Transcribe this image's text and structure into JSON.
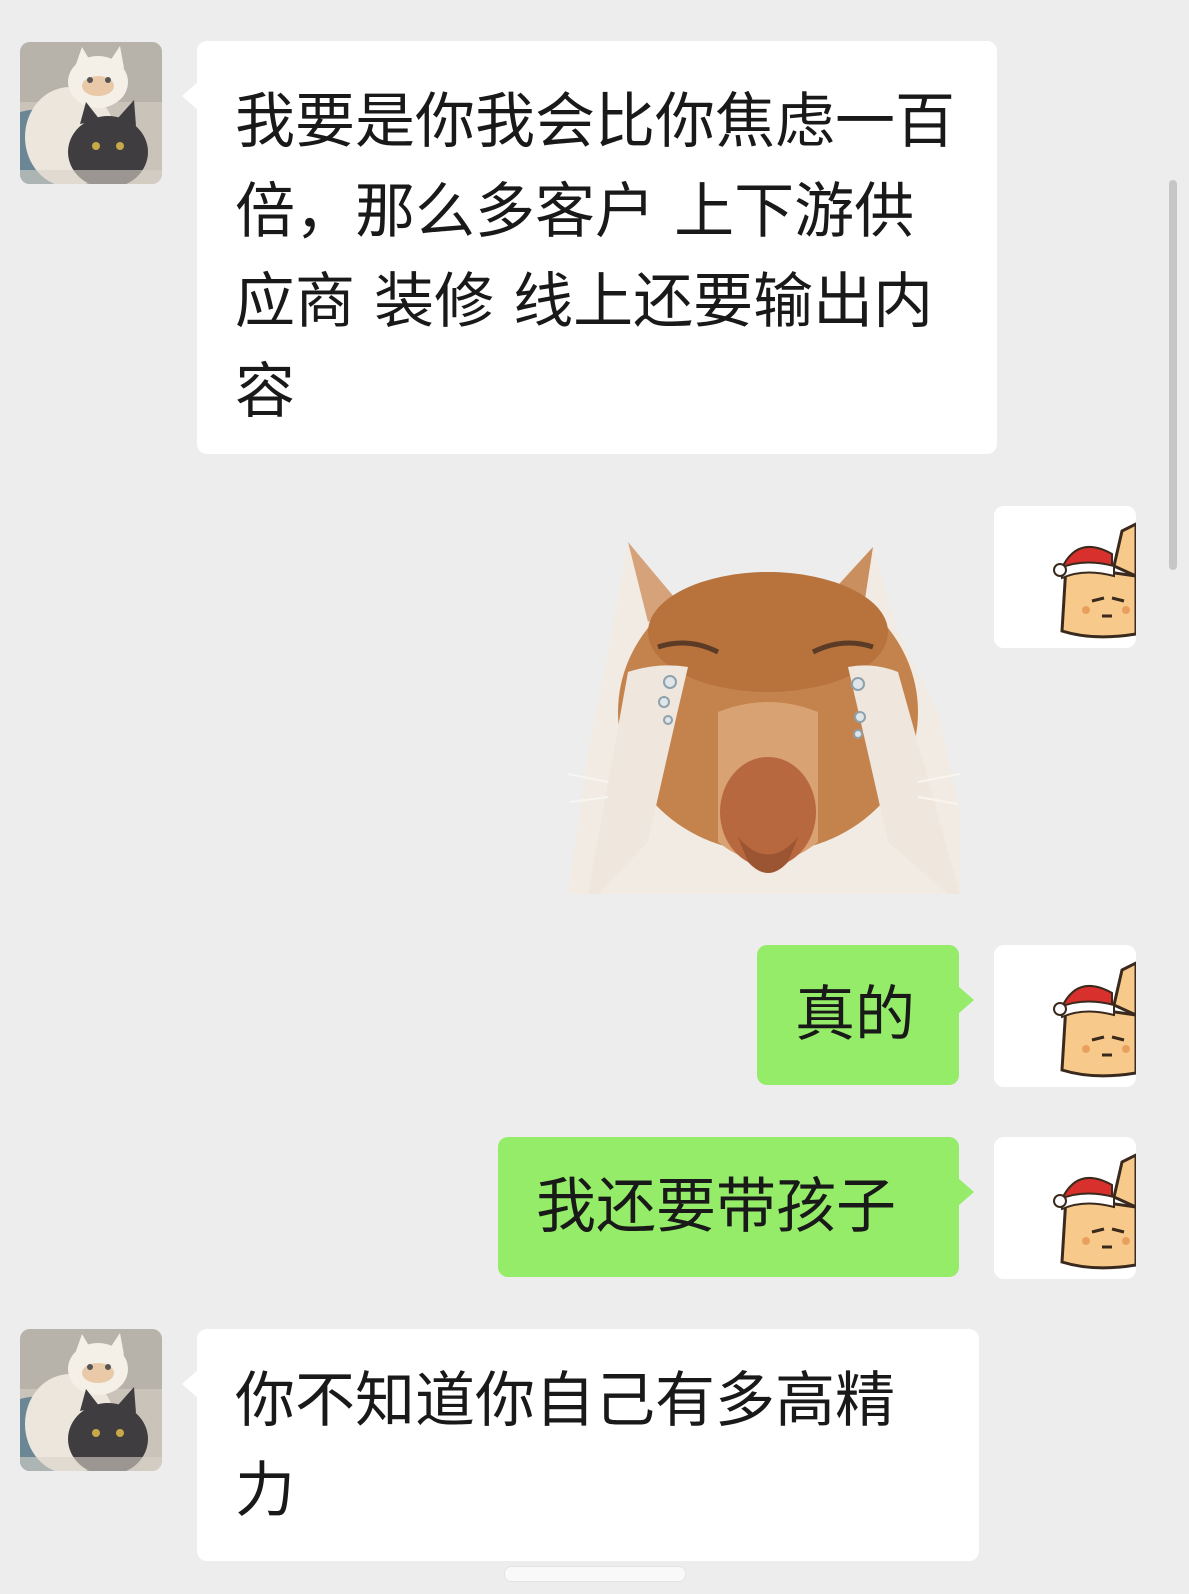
{
  "chat": {
    "messages": [
      {
        "sender": "friend",
        "type": "text",
        "text": "我要是你我会比你焦虑一百倍，那么多客户 上下游供应商 装修  线上还要输出内容"
      },
      {
        "sender": "me",
        "type": "sticker",
        "sticker": "crying-cat-sticker"
      },
      {
        "sender": "me",
        "type": "text",
        "text": "真的"
      },
      {
        "sender": "me",
        "type": "text",
        "text": "我还要带孩子"
      },
      {
        "sender": "friend",
        "type": "text",
        "text": "你不知道你自己有多高精力"
      }
    ]
  },
  "avatars": {
    "friend": "two-cats-avatar",
    "me": "santa-hat-cat-avatar"
  },
  "colors": {
    "background": "#ededed",
    "incoming_bubble": "#ffffff",
    "outgoing_bubble": "#95ec69",
    "text": "#191919"
  }
}
